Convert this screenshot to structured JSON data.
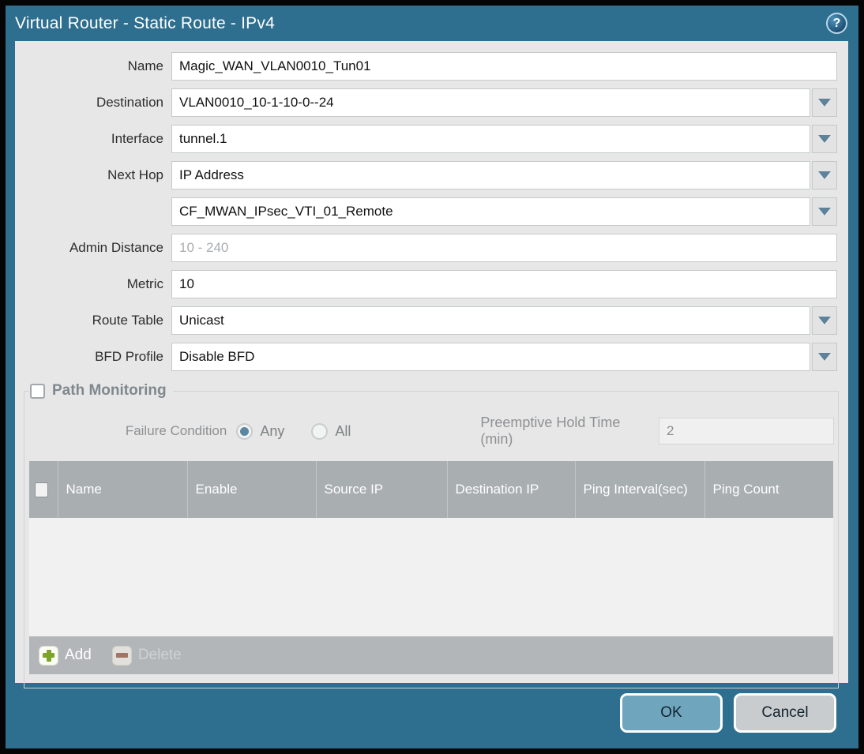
{
  "window": {
    "title": "Virtual Router - Static Route - IPv4",
    "help_glyph": "?"
  },
  "colors": {
    "titlebar_teal": "#2e6e8e",
    "panel_gray": "#e7e7e7",
    "table_header_gray": "#a9aeb1",
    "ok_button_blue": "#6fa6bd",
    "cancel_button_gray": "#c9cccf",
    "add_icon_green": "#7ba428",
    "delete_icon_red": "#9c5f4b",
    "dropdown_arrow": "#5d829a"
  },
  "fields": [
    {
      "label": "Name",
      "value": "Magic_WAN_VLAN0010_Tun01",
      "dropdown": false
    },
    {
      "label": "Destination",
      "value": "VLAN0010_10-1-10-0--24",
      "dropdown": true
    },
    {
      "label": "Interface",
      "value": "tunnel.1",
      "dropdown": true
    },
    {
      "label": "Next Hop",
      "value": "IP Address",
      "dropdown": true
    },
    {
      "label": "",
      "value": "CF_MWAN_IPsec_VTI_01_Remote",
      "dropdown": true
    },
    {
      "label": "Admin Distance",
      "value": "",
      "placeholder": "10 - 240",
      "dropdown": false
    },
    {
      "label": "Metric",
      "value": "10",
      "dropdown": false
    },
    {
      "label": "Route Table",
      "value": "Unicast",
      "dropdown": true
    },
    {
      "label": "BFD Profile",
      "value": "Disable BFD",
      "dropdown": true
    }
  ],
  "path_monitoring": {
    "legend": "Path Monitoring",
    "enabled": false,
    "failure_condition_label": "Failure Condition",
    "radio_any_label": "Any",
    "radio_all_label": "All",
    "radio_selected": "Any",
    "preemptive_label": "Preemptive Hold Time (min)",
    "preemptive_value": "2",
    "table": {
      "columns": [
        "Name",
        "Enable",
        "Source IP",
        "Destination IP",
        "Ping Interval(sec)",
        "Ping Count"
      ],
      "rows": []
    },
    "add_label": "Add",
    "delete_label": "Delete"
  },
  "footer": {
    "ok_label": "OK",
    "cancel_label": "Cancel"
  }
}
